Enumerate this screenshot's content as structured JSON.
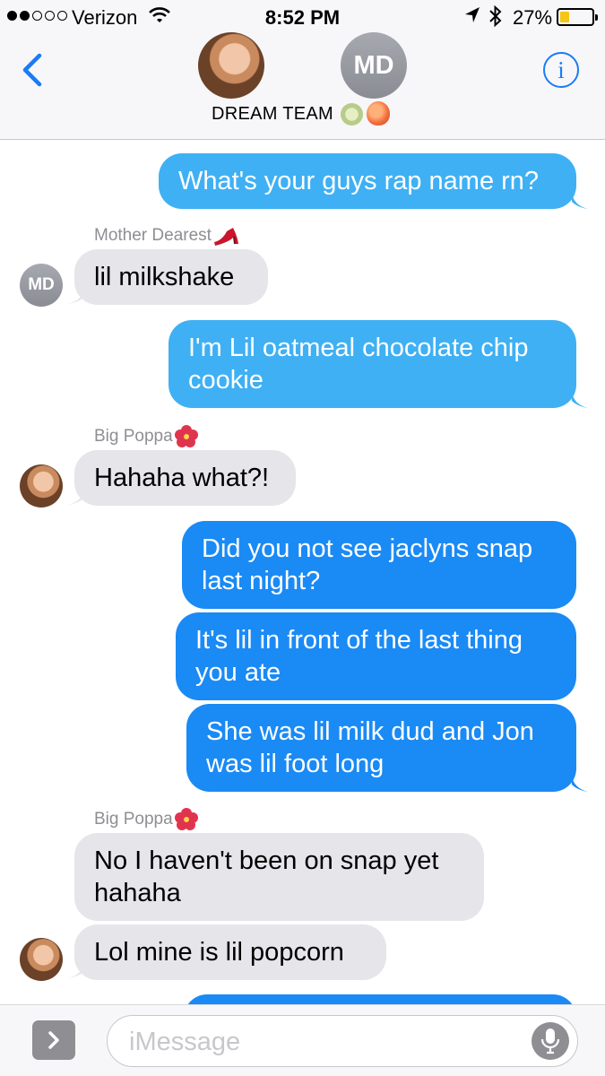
{
  "status_bar": {
    "carrier": "Verizon",
    "time": "8:52 PM",
    "battery_percent": "27%",
    "battery_level": 0.27,
    "signal_bars_filled": 2,
    "signal_bars_total": 5,
    "icons": [
      "wifi-icon",
      "location-arrow-icon",
      "bluetooth-icon",
      "battery-icon"
    ]
  },
  "header": {
    "group_name": "DREAM TEAM",
    "group_emojis": [
      "melon-emoji",
      "peach-emoji"
    ],
    "participant_initials": "MD",
    "info_label": "i",
    "icons": [
      "back-chevron-icon",
      "info-icon"
    ]
  },
  "senders": {
    "mother": "Mother Dearest",
    "poppa": "Big Poppa"
  },
  "messages": [
    {
      "from": "me",
      "text": "What's your guys rap name rn?"
    },
    {
      "from": "Mother Dearest",
      "text": "lil milkshake"
    },
    {
      "from": "me",
      "text": "I'm Lil oatmeal chocolate chip cookie"
    },
    {
      "from": "Big Poppa",
      "text": "Hahaha what?!"
    },
    {
      "from": "me",
      "text": "Did you not see jaclyns snap last night?"
    },
    {
      "from": "me",
      "text": "It's lil in front of the last thing you ate"
    },
    {
      "from": "me",
      "text": "She was lil milk dud and Jon was lil foot long"
    },
    {
      "from": "Big Poppa",
      "text": "No I haven't been on snap yet hahaha"
    },
    {
      "from": "Big Poppa",
      "text": "Lol mine is lil popcorn"
    }
  ],
  "avatar_initials": "MD",
  "input": {
    "placeholder": "iMessage",
    "icons": [
      "apps-chevron-icon",
      "microphone-icon"
    ]
  },
  "colors": {
    "outgoing_bubble": "#1a8af5",
    "outgoing_bubble_light": "#3fb0f4",
    "incoming_bubble": "#e5e5ea",
    "accent": "#1a7cf5"
  }
}
